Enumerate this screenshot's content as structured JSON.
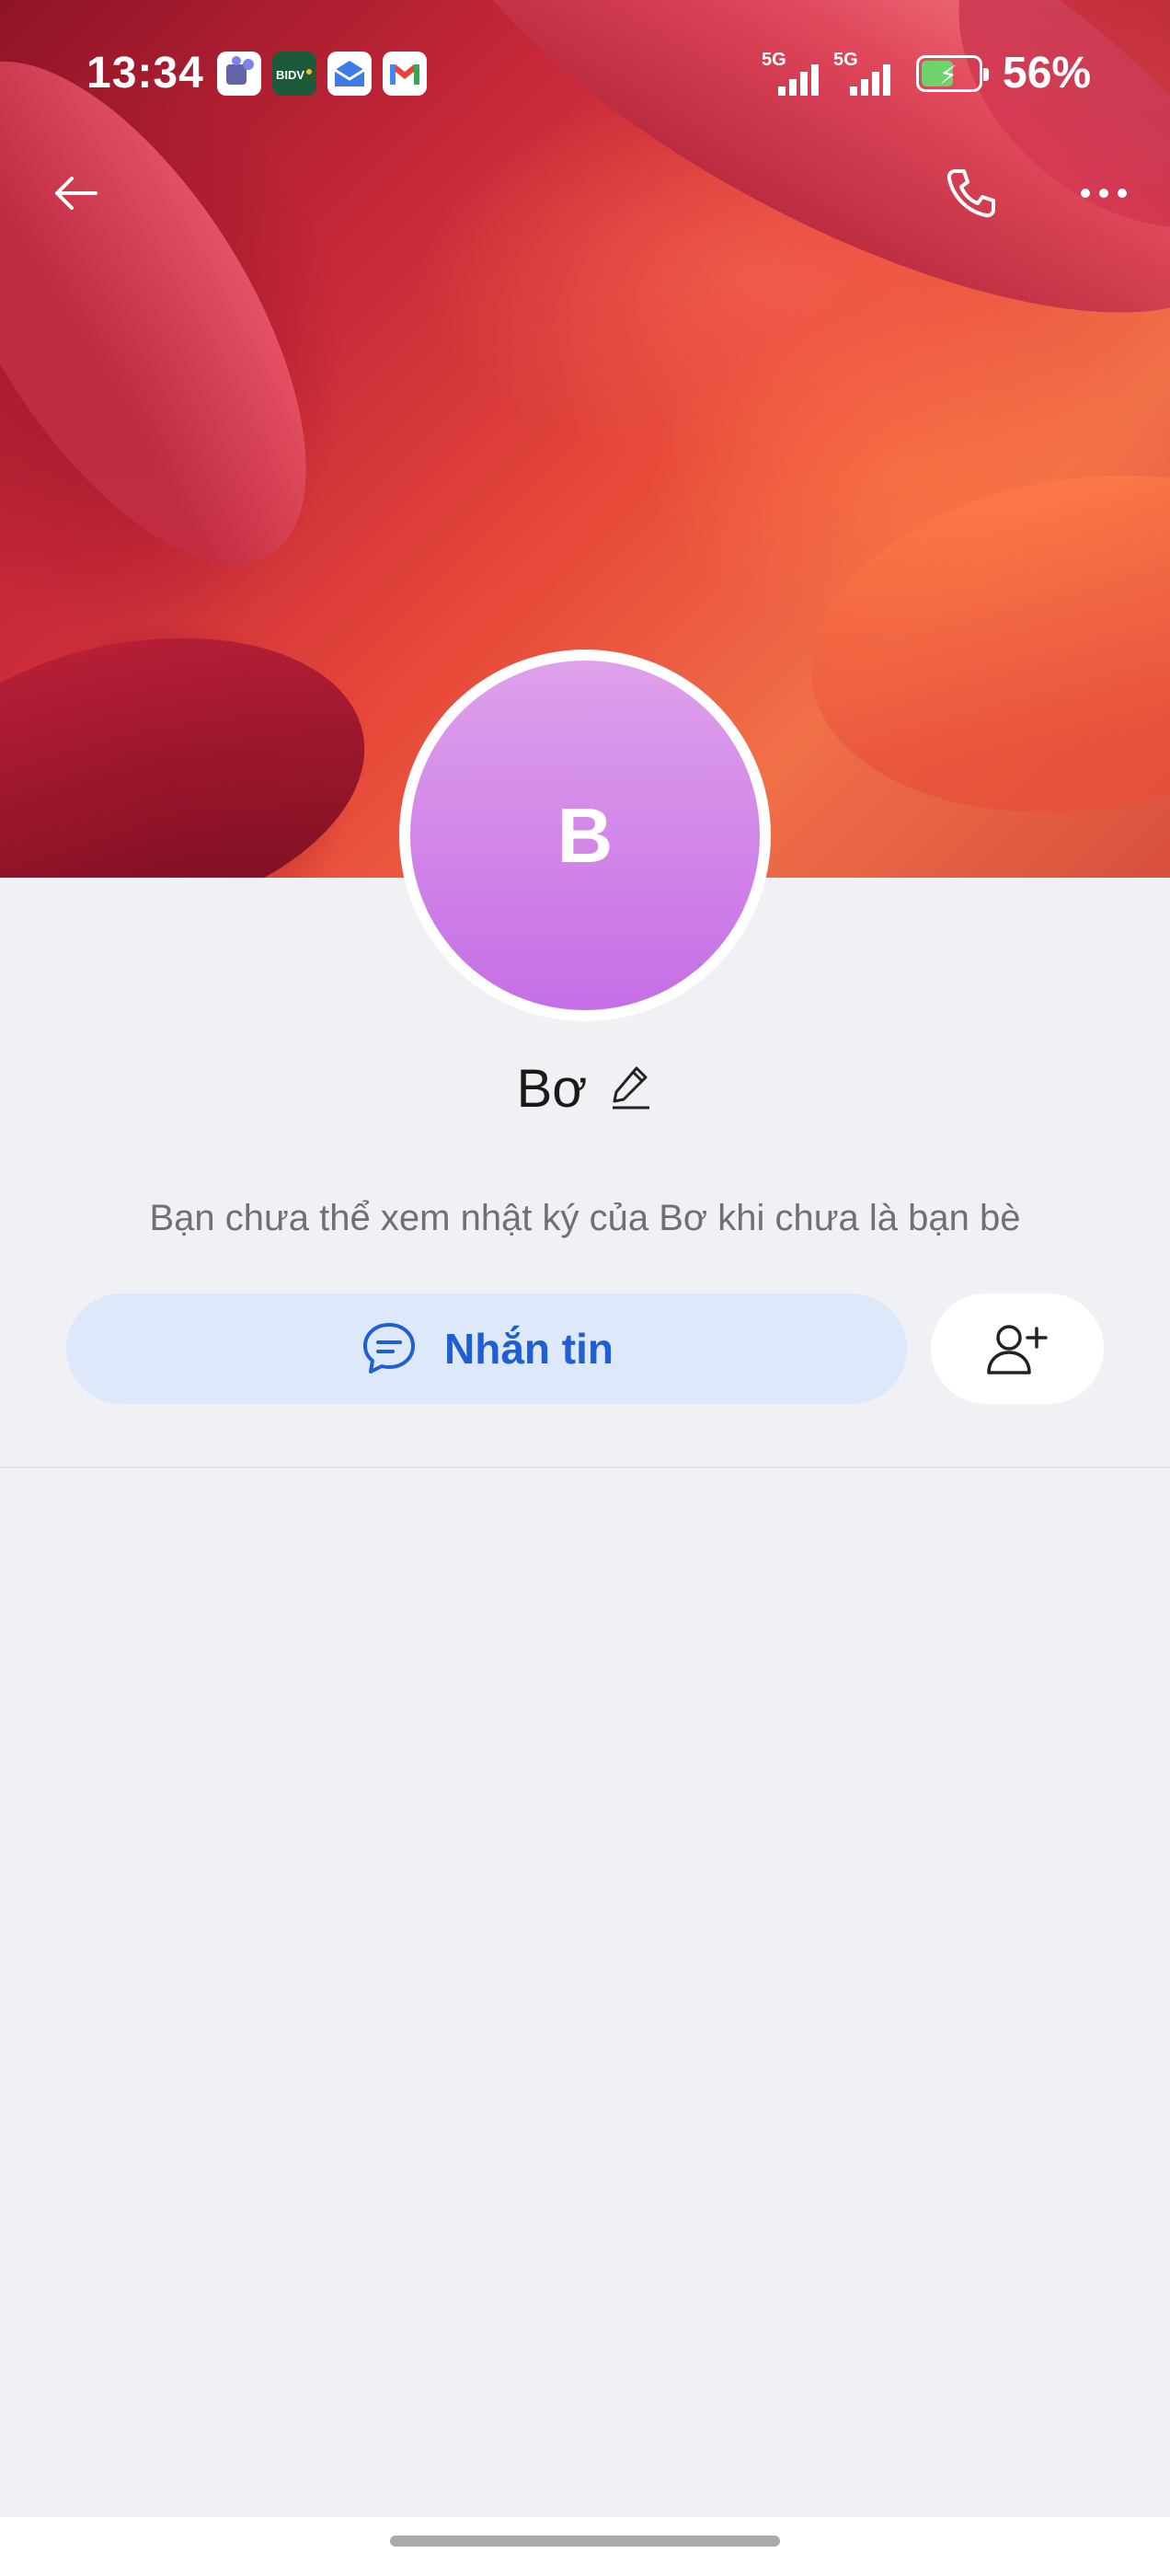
{
  "status_bar": {
    "time": "13:34",
    "network1": "5G",
    "network2": "5G",
    "battery_percent": "56%",
    "battery_level": 0.56,
    "notification_icons": [
      "teams-icon",
      "bidv-icon",
      "mail-box-icon",
      "gmail-icon"
    ]
  },
  "header": {
    "back_icon": "arrow-left-icon",
    "call_icon": "phone-icon",
    "more_icon": "more-dots-icon"
  },
  "profile": {
    "avatar_initial": "B",
    "name": "Bơ",
    "edit_icon": "pencil-icon",
    "notice": "Bạn chưa thể xem nhật ký của Bơ khi chưa là bạn bè"
  },
  "actions": {
    "message_label": "Nhắn tin",
    "message_icon": "chat-bubble-icon",
    "add_friend_icon": "add-friend-icon"
  },
  "colors": {
    "accent": "#1f5fd3",
    "message_button_bg": "#dde8fb",
    "avatar_gradient_top": "#dea1ea",
    "avatar_gradient_bottom": "#c66ee6",
    "page_bg": "#f0f1f5"
  }
}
